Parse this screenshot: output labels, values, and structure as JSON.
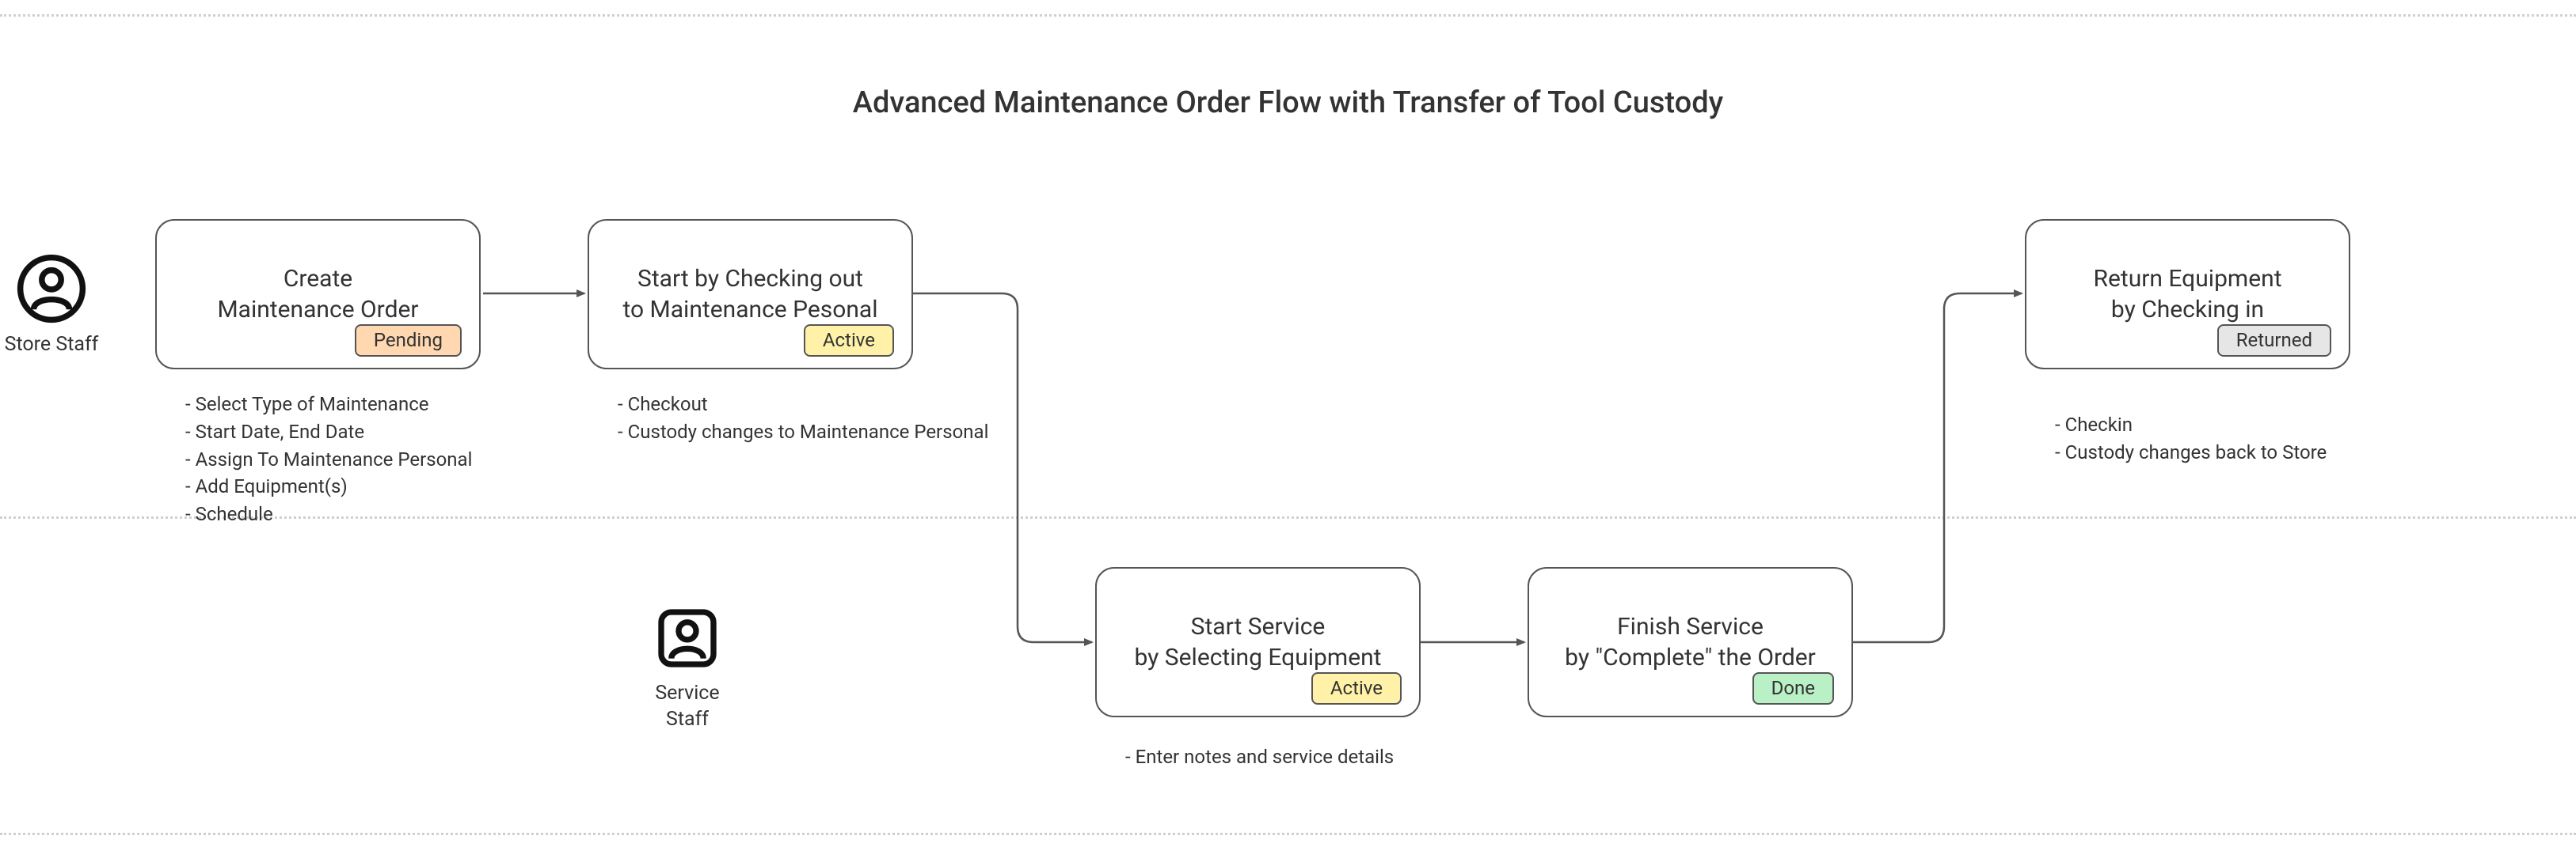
{
  "title": "Advanced Maintenance Order Flow with Transfer of Tool Custody",
  "actors": {
    "store": {
      "label": "Store\nStaff"
    },
    "service": {
      "label": "Service\nStaff"
    }
  },
  "nodes": {
    "create": {
      "line1": "Create",
      "line2": "Maintenance Order",
      "badge": "Pending",
      "notes": "- Select Type of Maintenance\n- Start Date, End Date\n- Assign To Maintenance Personal\n- Add Equipment(s)\n- Schedule"
    },
    "checkout": {
      "line1": "Start by Checking out",
      "line2": "to Maintenance Pesonal",
      "badge": "Active",
      "notes": "- Checkout\n- Custody changes to Maintenance Personal"
    },
    "startservice": {
      "line1": "Start Service",
      "line2": "by Selecting Equipment",
      "badge": "Active",
      "notes": "- Enter notes and service details"
    },
    "finish": {
      "line1": "Finish Service",
      "line2": "by \"Complete\" the Order",
      "badge": "Done"
    },
    "return": {
      "line1": "Return Equipment",
      "line2": "by Checking in",
      "badge": "Returned",
      "notes": "- Checkin\n- Custody changes back to Store"
    }
  }
}
